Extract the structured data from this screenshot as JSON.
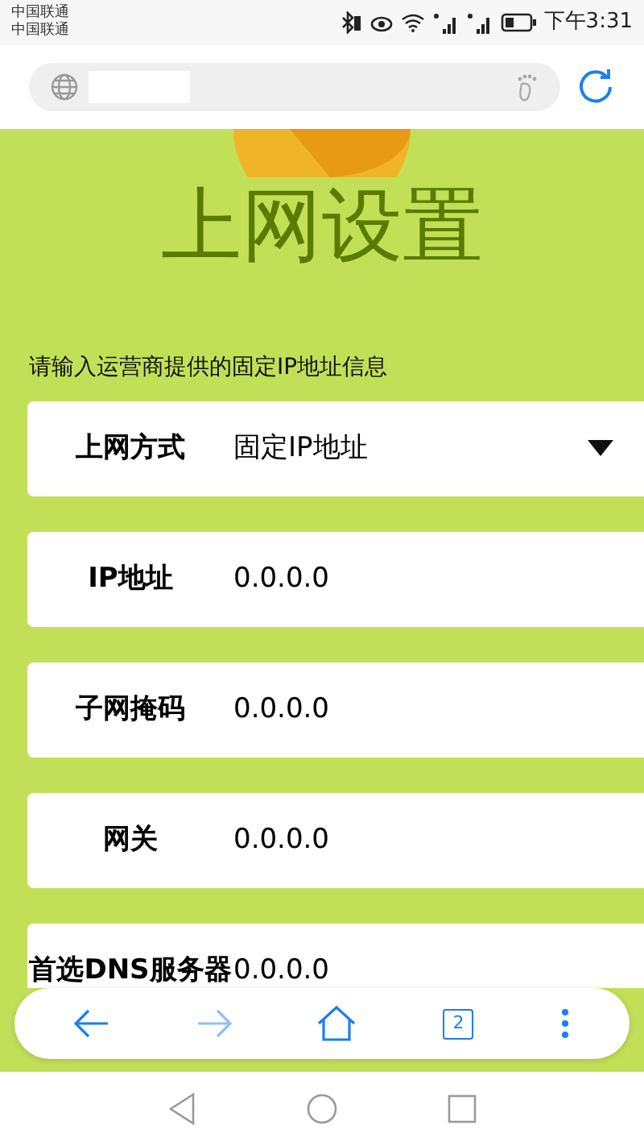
{
  "status_bar": {
    "carriers": [
      "中国联通",
      "中国联通"
    ],
    "time": "下午3:31"
  },
  "page": {
    "title": "上网设置",
    "subtitle": "请输入运营商提供的固定IP地址信息",
    "fields": [
      {
        "kind": "select",
        "label": "上网方式",
        "value": "固定IP地址"
      },
      {
        "kind": "text",
        "label": "IP地址",
        "value": "0.0.0.0"
      },
      {
        "kind": "text",
        "label": "子网掩码",
        "value": "0.0.0.0"
      },
      {
        "kind": "text",
        "label": "网关",
        "value": "0.0.0.0"
      },
      {
        "kind": "text",
        "label": "首选DNS服务器",
        "value": "0.0.0.0"
      }
    ]
  },
  "toolbar": {
    "tab_count": "2"
  }
}
